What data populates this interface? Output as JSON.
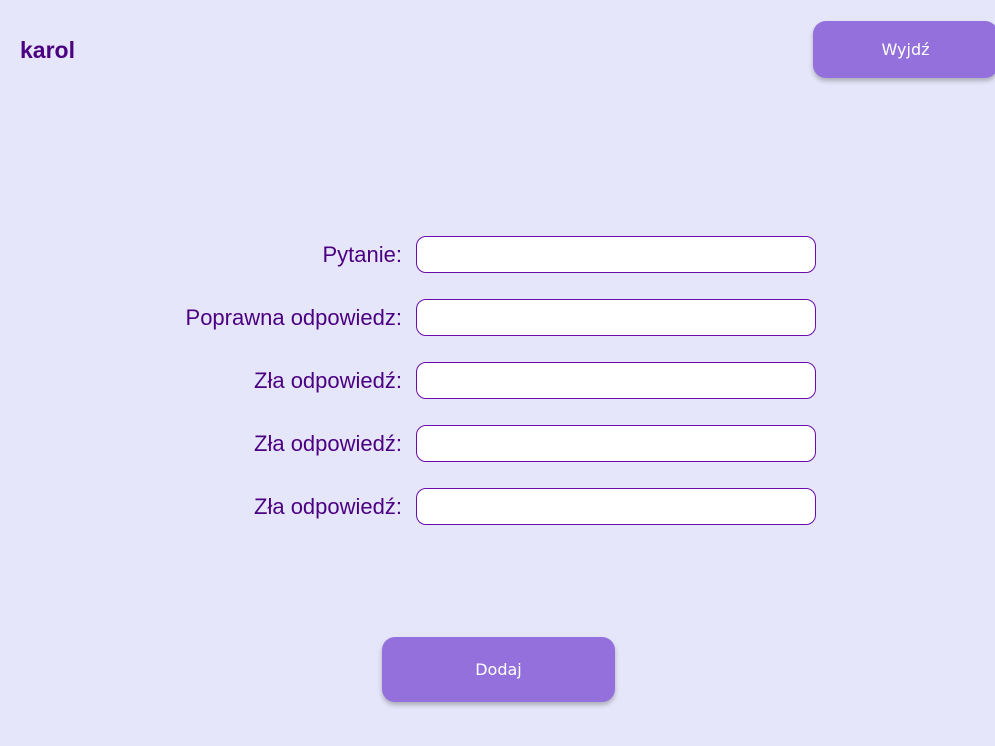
{
  "header": {
    "username": "karol",
    "logout_label": "Wyjdź"
  },
  "form": {
    "fields": [
      {
        "label": "Pytanie:",
        "value": "",
        "placeholder": ""
      },
      {
        "label": "Poprawna odpowiedz:",
        "value": "",
        "placeholder": ""
      },
      {
        "label": "Zła odpowiedź:",
        "value": "",
        "placeholder": ""
      },
      {
        "label": "Zła odpowiedź:",
        "value": "",
        "placeholder": ""
      },
      {
        "label": "Zła odpowiedź:",
        "value": "",
        "placeholder": ""
      }
    ],
    "submit_label": "Dodaj"
  },
  "colors": {
    "background": "#e6e6fa",
    "accent": "#9370db",
    "text": "#4b0082",
    "input_border": "#6a0dad"
  }
}
